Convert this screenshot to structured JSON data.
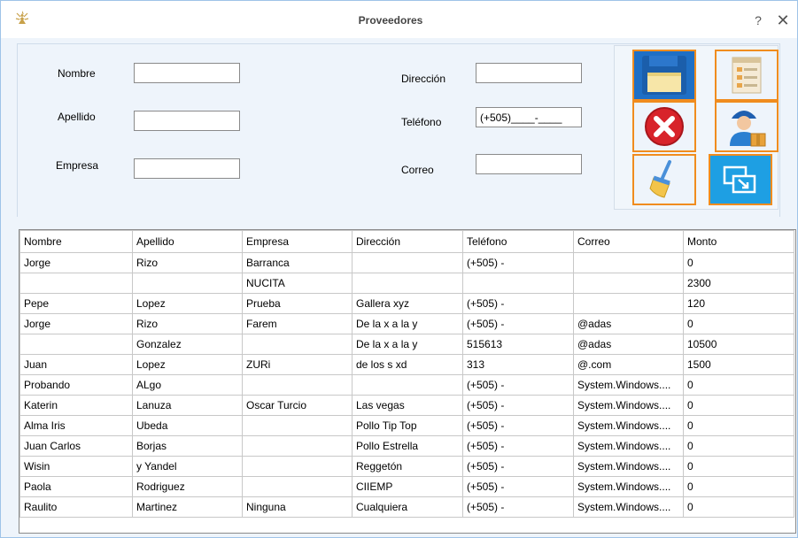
{
  "window": {
    "title": "Proveedores",
    "help": "?",
    "close": "✕"
  },
  "form": {
    "nombre_label": "Nombre",
    "apellido_label": "Apellido",
    "empresa_label": "Empresa",
    "direccion_label": "Dirección",
    "telefono_label": "Teléfono",
    "correo_label": "Correo",
    "nombre_value": "",
    "apellido_value": "",
    "empresa_value": "",
    "direccion_value": "",
    "telefono_value": "(+505)____-____",
    "correo_value": ""
  },
  "buttons": {
    "save_icon": "floppy-disk-icon",
    "report_icon": "document-list-icon",
    "delete_icon": "red-x-icon",
    "supplier_icon": "delivery-person-icon",
    "clear_icon": "broom-icon",
    "exit_icon": "exit-window-icon",
    "accent": "#f08c1e"
  },
  "table": {
    "columns": [
      "Nombre",
      "Apellido",
      "Empresa",
      "Dirección",
      "Teléfono",
      "Correo",
      "Monto"
    ],
    "rows": [
      [
        "Jorge",
        "Rizo",
        "Barranca",
        "",
        "(+505)    -",
        "",
        "0"
      ],
      [
        "",
        "",
        "NUCITA",
        "",
        "",
        "",
        "2300"
      ],
      [
        "Pepe",
        "Lopez",
        "Prueba",
        "Gallera xyz",
        "(+505)    -",
        "",
        "120"
      ],
      [
        "Jorge",
        "Rizo",
        "Farem",
        "De la x a la y",
        "(+505)    -",
        "@adas",
        "0"
      ],
      [
        "",
        "Gonzalez",
        "",
        "De la x a la y",
        "515613",
        "@adas",
        "10500"
      ],
      [
        "Juan",
        "Lopez",
        "ZURi",
        "de los s xd",
        "313",
        "@.com",
        "1500"
      ],
      [
        "Probando",
        "ALgo",
        "",
        "",
        "(+505)    -",
        "System.Windows....",
        "0"
      ],
      [
        "Katerin",
        "Lanuza",
        "Oscar Turcio",
        "Las vegas",
        "(+505)    -",
        "System.Windows....",
        "0"
      ],
      [
        "Alma Iris",
        "Ubeda",
        "",
        "Pollo Tip Top",
        "(+505)    -",
        "System.Windows....",
        "0"
      ],
      [
        "Juan Carlos",
        "Borjas",
        "",
        "Pollo Estrella",
        "(+505)    -",
        "System.Windows....",
        "0"
      ],
      [
        "Wisin",
        "y Yandel",
        "",
        "Reggetón",
        "(+505)    -",
        "System.Windows....",
        "0"
      ],
      [
        "Paola",
        "Rodriguez",
        "",
        "CIIEMP",
        "(+505)    -",
        "System.Windows....",
        "0"
      ],
      [
        "Raulito",
        "Martinez",
        "Ninguna",
        "Cualquiera",
        "(+505)    -",
        "System.Windows....",
        "0"
      ]
    ]
  }
}
